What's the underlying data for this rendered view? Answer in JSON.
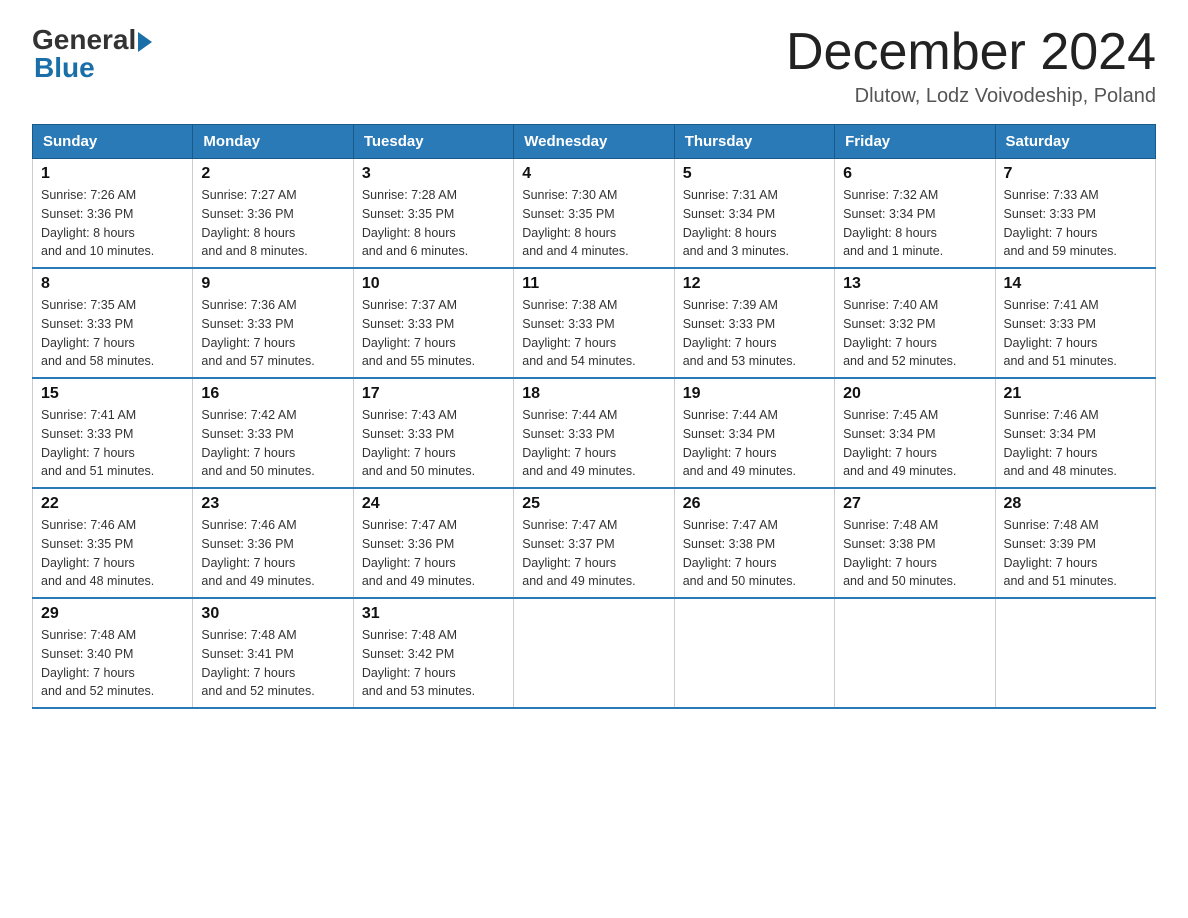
{
  "logo": {
    "general": "General",
    "blue": "Blue"
  },
  "header": {
    "month_title": "December 2024",
    "location": "Dlutow, Lodz Voivodeship, Poland"
  },
  "days_of_week": [
    "Sunday",
    "Monday",
    "Tuesday",
    "Wednesday",
    "Thursday",
    "Friday",
    "Saturday"
  ],
  "weeks": [
    [
      {
        "day": "1",
        "sunrise": "7:26 AM",
        "sunset": "3:36 PM",
        "daylight": "8 hours and 10 minutes."
      },
      {
        "day": "2",
        "sunrise": "7:27 AM",
        "sunset": "3:36 PM",
        "daylight": "8 hours and 8 minutes."
      },
      {
        "day": "3",
        "sunrise": "7:28 AM",
        "sunset": "3:35 PM",
        "daylight": "8 hours and 6 minutes."
      },
      {
        "day": "4",
        "sunrise": "7:30 AM",
        "sunset": "3:35 PM",
        "daylight": "8 hours and 4 minutes."
      },
      {
        "day": "5",
        "sunrise": "7:31 AM",
        "sunset": "3:34 PM",
        "daylight": "8 hours and 3 minutes."
      },
      {
        "day": "6",
        "sunrise": "7:32 AM",
        "sunset": "3:34 PM",
        "daylight": "8 hours and 1 minute."
      },
      {
        "day": "7",
        "sunrise": "7:33 AM",
        "sunset": "3:33 PM",
        "daylight": "7 hours and 59 minutes."
      }
    ],
    [
      {
        "day": "8",
        "sunrise": "7:35 AM",
        "sunset": "3:33 PM",
        "daylight": "7 hours and 58 minutes."
      },
      {
        "day": "9",
        "sunrise": "7:36 AM",
        "sunset": "3:33 PM",
        "daylight": "7 hours and 57 minutes."
      },
      {
        "day": "10",
        "sunrise": "7:37 AM",
        "sunset": "3:33 PM",
        "daylight": "7 hours and 55 minutes."
      },
      {
        "day": "11",
        "sunrise": "7:38 AM",
        "sunset": "3:33 PM",
        "daylight": "7 hours and 54 minutes."
      },
      {
        "day": "12",
        "sunrise": "7:39 AM",
        "sunset": "3:33 PM",
        "daylight": "7 hours and 53 minutes."
      },
      {
        "day": "13",
        "sunrise": "7:40 AM",
        "sunset": "3:32 PM",
        "daylight": "7 hours and 52 minutes."
      },
      {
        "day": "14",
        "sunrise": "7:41 AM",
        "sunset": "3:33 PM",
        "daylight": "7 hours and 51 minutes."
      }
    ],
    [
      {
        "day": "15",
        "sunrise": "7:41 AM",
        "sunset": "3:33 PM",
        "daylight": "7 hours and 51 minutes."
      },
      {
        "day": "16",
        "sunrise": "7:42 AM",
        "sunset": "3:33 PM",
        "daylight": "7 hours and 50 minutes."
      },
      {
        "day": "17",
        "sunrise": "7:43 AM",
        "sunset": "3:33 PM",
        "daylight": "7 hours and 50 minutes."
      },
      {
        "day": "18",
        "sunrise": "7:44 AM",
        "sunset": "3:33 PM",
        "daylight": "7 hours and 49 minutes."
      },
      {
        "day": "19",
        "sunrise": "7:44 AM",
        "sunset": "3:34 PM",
        "daylight": "7 hours and 49 minutes."
      },
      {
        "day": "20",
        "sunrise": "7:45 AM",
        "sunset": "3:34 PM",
        "daylight": "7 hours and 49 minutes."
      },
      {
        "day": "21",
        "sunrise": "7:46 AM",
        "sunset": "3:34 PM",
        "daylight": "7 hours and 48 minutes."
      }
    ],
    [
      {
        "day": "22",
        "sunrise": "7:46 AM",
        "sunset": "3:35 PM",
        "daylight": "7 hours and 48 minutes."
      },
      {
        "day": "23",
        "sunrise": "7:46 AM",
        "sunset": "3:36 PM",
        "daylight": "7 hours and 49 minutes."
      },
      {
        "day": "24",
        "sunrise": "7:47 AM",
        "sunset": "3:36 PM",
        "daylight": "7 hours and 49 minutes."
      },
      {
        "day": "25",
        "sunrise": "7:47 AM",
        "sunset": "3:37 PM",
        "daylight": "7 hours and 49 minutes."
      },
      {
        "day": "26",
        "sunrise": "7:47 AM",
        "sunset": "3:38 PM",
        "daylight": "7 hours and 50 minutes."
      },
      {
        "day": "27",
        "sunrise": "7:48 AM",
        "sunset": "3:38 PM",
        "daylight": "7 hours and 50 minutes."
      },
      {
        "day": "28",
        "sunrise": "7:48 AM",
        "sunset": "3:39 PM",
        "daylight": "7 hours and 51 minutes."
      }
    ],
    [
      {
        "day": "29",
        "sunrise": "7:48 AM",
        "sunset": "3:40 PM",
        "daylight": "7 hours and 52 minutes."
      },
      {
        "day": "30",
        "sunrise": "7:48 AM",
        "sunset": "3:41 PM",
        "daylight": "7 hours and 52 minutes."
      },
      {
        "day": "31",
        "sunrise": "7:48 AM",
        "sunset": "3:42 PM",
        "daylight": "7 hours and 53 minutes."
      },
      null,
      null,
      null,
      null
    ]
  ],
  "labels": {
    "sunrise": "Sunrise:",
    "sunset": "Sunset:",
    "daylight": "Daylight:"
  }
}
